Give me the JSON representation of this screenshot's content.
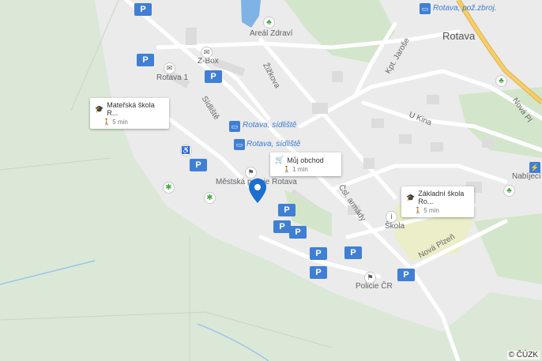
{
  "map": {
    "town_label": "Rotava",
    "area_labels": [
      "Areál Zdraví",
      "Rotava 1",
      "Z-Box",
      "Městská policie Rotava",
      "Škola",
      "Policie ČR",
      "Nabíjecí s"
    ],
    "street_labels": [
      "Žižkova",
      "Sídliště",
      "Kpt. Jaroše",
      "U Kina",
      "Čsl. armády",
      "Nová Plzeň",
      "Nová Pl"
    ],
    "transit_labels": [
      "Rotava, sídliště",
      "Rotava, sídliště",
      "Rotava, pož.zbroj."
    ],
    "parking_symbol": "P",
    "copyright": "© ČÚZK"
  },
  "callouts": [
    {
      "title": "Mateřská škola R...",
      "sub": "5 min",
      "icon": "school-icon"
    },
    {
      "title": "Můj obchod",
      "sub": "1 min",
      "icon": "cart-icon"
    },
    {
      "title": "Základní škola Ro...",
      "sub": "5 min",
      "icon": "school-icon"
    }
  ],
  "colors": {
    "water": "#7fb3e6",
    "park_green": "#cfe5c8",
    "road": "#ffffff",
    "highway": "#f4c34b",
    "pin": "#1a6fd1",
    "parking": "#3f7fd4"
  }
}
